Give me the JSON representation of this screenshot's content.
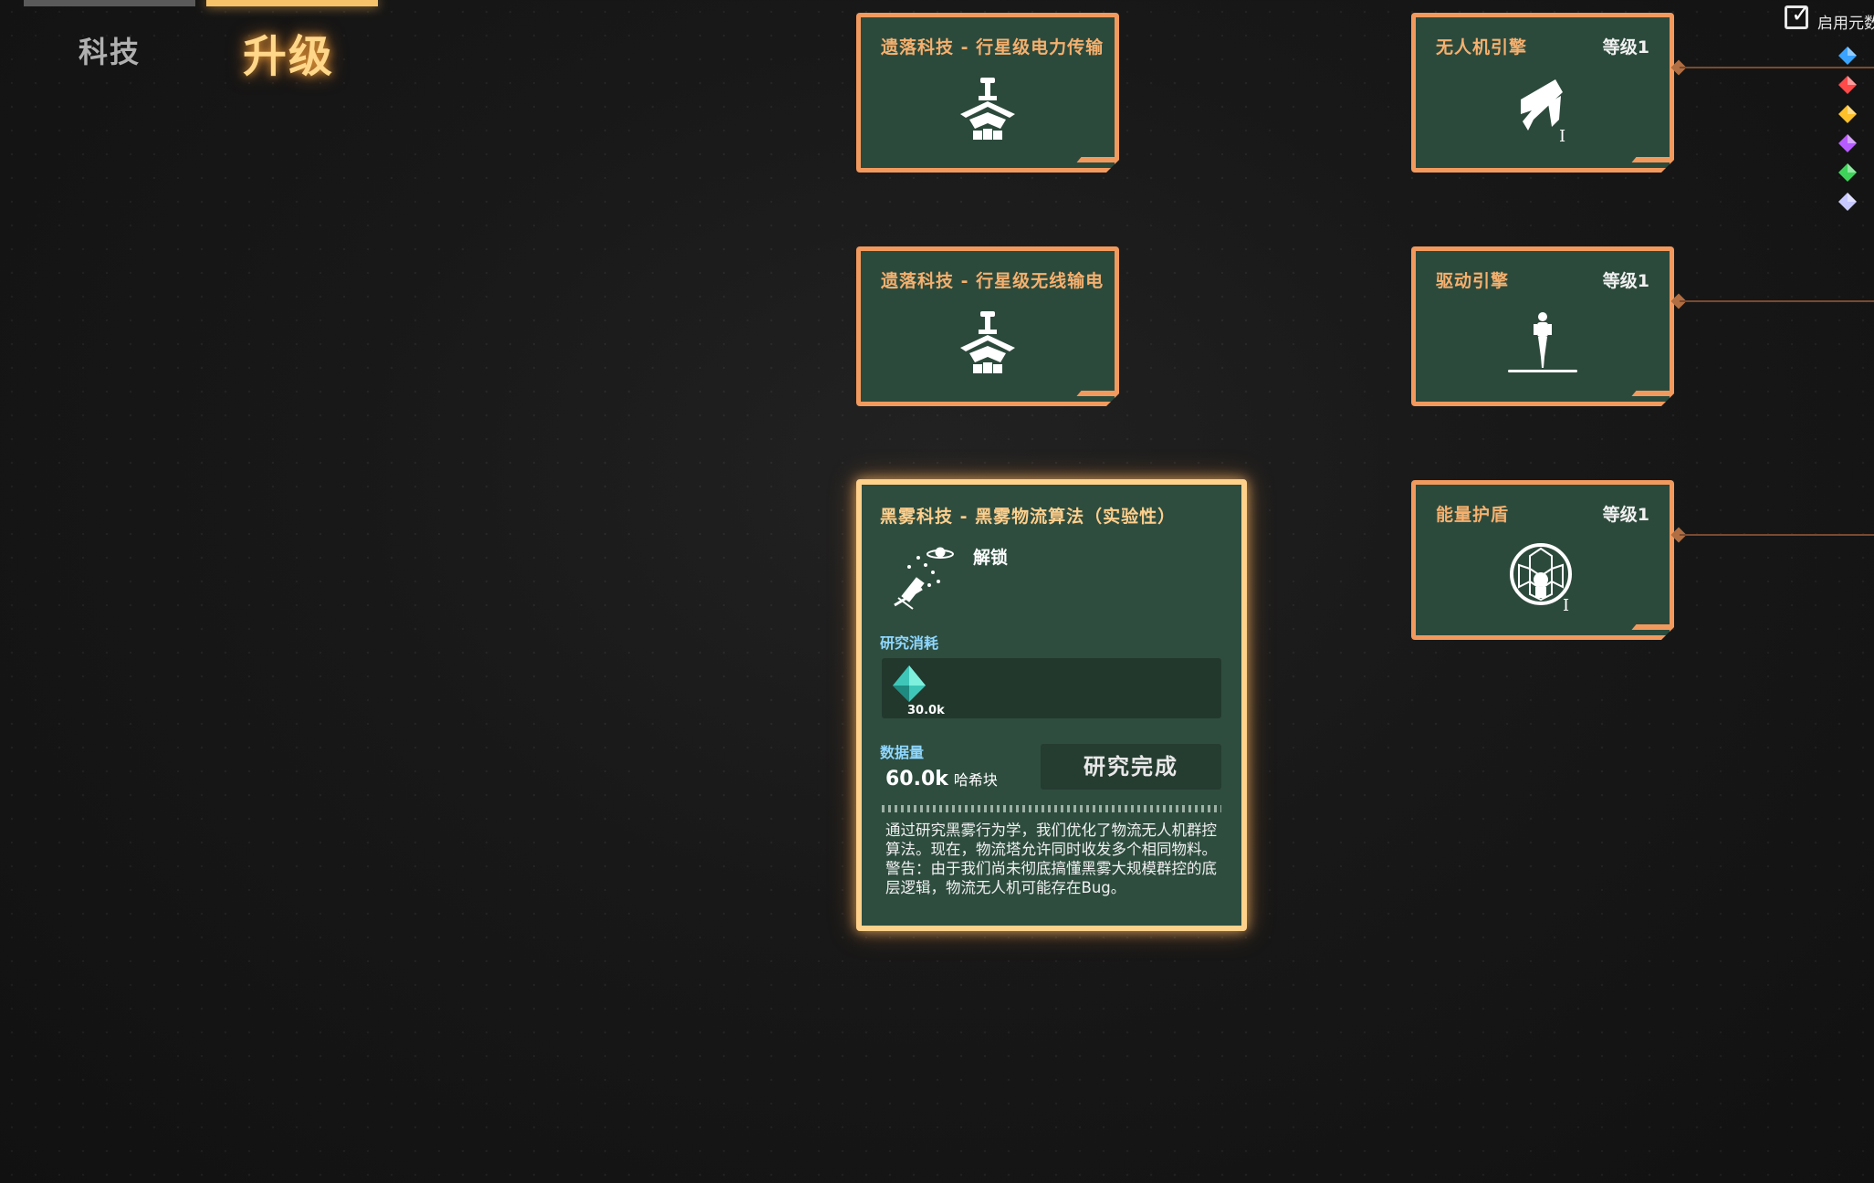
{
  "tabs": [
    {
      "label": "科技",
      "active": false
    },
    {
      "label": "升级",
      "active": true
    }
  ],
  "cards": {
    "power_transfer": {
      "title": "遗落科技 - 行星级电力传输",
      "icon": "pylon-icon"
    },
    "wireless_power": {
      "title": "遗落科技 - 行星级无线输电",
      "icon": "pylon-icon"
    },
    "drone_engine": {
      "title": "无人机引擎",
      "level": "等级1",
      "icon": "drone-engine-icon",
      "roman": "I"
    },
    "drive_engine": {
      "title": "驱动引擎",
      "level": "等级1",
      "icon": "mecha-icon"
    },
    "energy_shield": {
      "title": "能量护盾",
      "level": "等级1",
      "icon": "shield-dome-icon",
      "roman": "I"
    }
  },
  "detail": {
    "title": "黑雾科技 - 黑雾物流算法（实验性）",
    "unlock_label": "解锁",
    "cost_label": "研究消耗",
    "cost_amount": "30.0k",
    "data_label": "数据量",
    "data_value": "60.0k",
    "data_unit": "哈希块",
    "button_label": "研究完成",
    "description": "通过研究黑雾行为学，我们优化了物流无人机群控算法。现在，物流塔允许同时收发多个相同物料。警告：由于我们尚未彻底搞懂黑雾大规模群控的底层逻辑，物流无人机可能存在Bug。"
  },
  "top_right": {
    "enable_label": "启用元数",
    "checked": true
  },
  "colors": {
    "card_border": "#f29a5e",
    "card_fill": "#2c4a3c",
    "highlight_border": "#ffd18a",
    "tab_active": "#ffd78a",
    "cost_label": "#8fd7ff"
  },
  "gems": [
    {
      "name": "blue-matrix-icon",
      "color": "#3aa2ff"
    },
    {
      "name": "red-matrix-icon",
      "color": "#ff4a4a"
    },
    {
      "name": "yellow-matrix-icon",
      "color": "#ffc02a"
    },
    {
      "name": "purple-matrix-icon",
      "color": "#b65cff"
    },
    {
      "name": "green-matrix-icon",
      "color": "#3ed45a"
    },
    {
      "name": "white-matrix-icon",
      "color": "#c8c8ff"
    }
  ]
}
